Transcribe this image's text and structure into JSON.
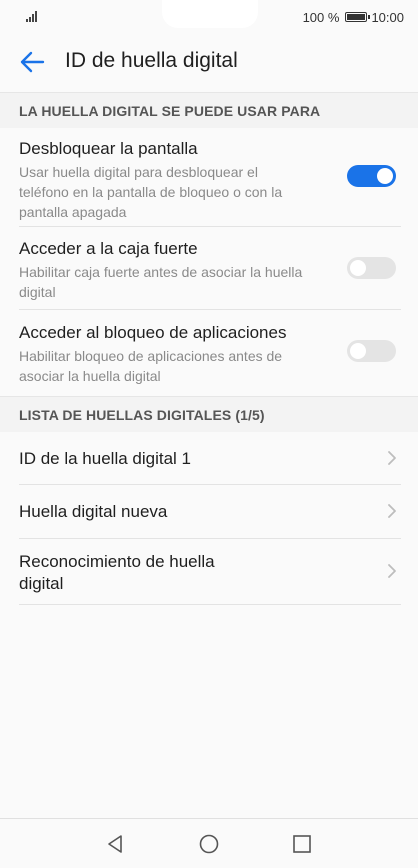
{
  "status_bar": {
    "battery": "100 %",
    "time": "10:00"
  },
  "header": {
    "title": "ID de huella digital"
  },
  "section_usage": {
    "title": "LA HUELLA DIGITAL SE PUEDE USAR PARA",
    "items": [
      {
        "title": "Desbloquear la pantalla",
        "subtitle_lines": [
          "Usar huella digital para desbloquear el",
          "teléfono en la pantalla de bloqueo o con la",
          "pantalla apagada"
        ],
        "enabled": true
      },
      {
        "title": "Acceder a la caja fuerte",
        "subtitle_lines": [
          "Habilitar caja fuerte antes de asociar la huella",
          "digital"
        ],
        "enabled": false
      },
      {
        "title": "Acceder al bloqueo de aplicaciones",
        "subtitle_lines": [
          "Habilitar bloqueo de aplicaciones antes de",
          "asociar la huella digital"
        ],
        "enabled": false
      }
    ]
  },
  "section_list": {
    "title": "LISTA DE HUELLAS DIGITALES (1/5)",
    "items": [
      {
        "lines": [
          "ID de la huella digital 1"
        ]
      },
      {
        "lines": [
          "Huella digital nueva"
        ]
      },
      {
        "lines": [
          "Reconocimiento de huella",
          "digital"
        ]
      }
    ]
  },
  "icons": {
    "back": "back-arrow-icon",
    "chevron": "chevron-right-icon",
    "nav_back": "triangle-back-icon",
    "nav_home": "circle-home-icon",
    "nav_recents": "square-recents-icon"
  },
  "colors": {
    "accent": "#1a73e8",
    "toggle_off": "#e4e4e4"
  }
}
